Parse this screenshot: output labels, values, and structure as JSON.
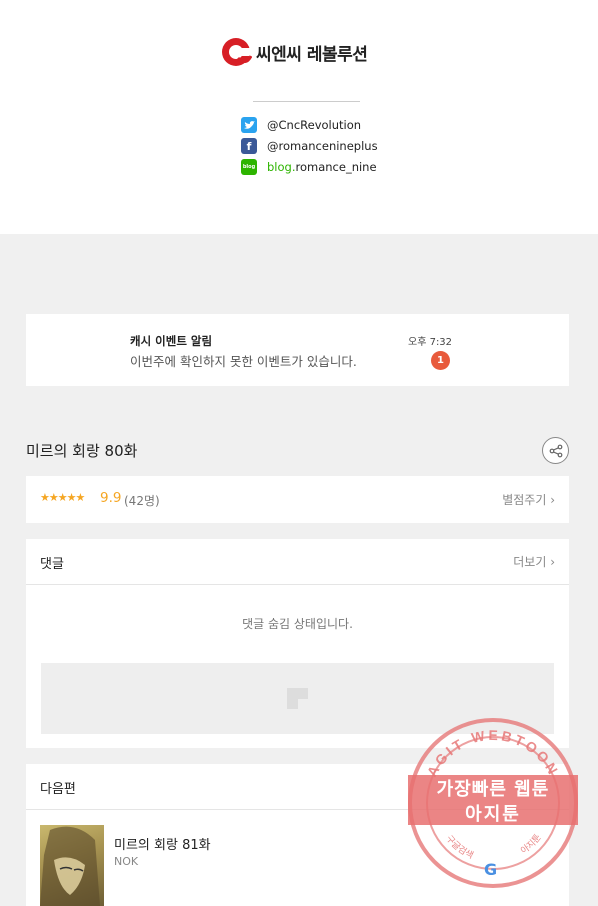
{
  "header": {
    "logo_text": "씨엔씨 레볼루션",
    "social": [
      {
        "icon": "twitter-icon",
        "handle": "@CncRevolution"
      },
      {
        "icon": "facebook-icon",
        "handle": "@romancenineplus"
      },
      {
        "icon": "blog-icon",
        "icon_label": "blog",
        "prefix": "blog.",
        "handle": "romance_nine"
      }
    ]
  },
  "notification": {
    "title": "캐시 이벤트 알림",
    "message": "이번주에 확인하지 못한 이벤트가 있습니다.",
    "time": "오후 7:32",
    "badge": "1"
  },
  "episode": {
    "title": "미르의 회랑 80화",
    "stars": "★★★★★",
    "score": "9.9",
    "count": "(42명)",
    "rate_label": "별점주기 ›"
  },
  "comments": {
    "title": "댓글",
    "more_label": "더보기 ›",
    "hidden_message": "댓글 숨김 상태입니다."
  },
  "next": {
    "title": "다음편",
    "episode_title": "미르의 회랑 81화",
    "author": "NOK"
  },
  "watermark": {
    "arc_text": "AGIT WEBTOON",
    "line1": "가장빠른 웹툰",
    "line2": "아지툰",
    "left_small": "구글검색",
    "right_small": "아지툰"
  },
  "colors": {
    "accent_red": "#e85a3c",
    "star": "#f5a623",
    "twitter": "#2aa3ef",
    "facebook": "#3b5998",
    "blog": "#2db400"
  }
}
